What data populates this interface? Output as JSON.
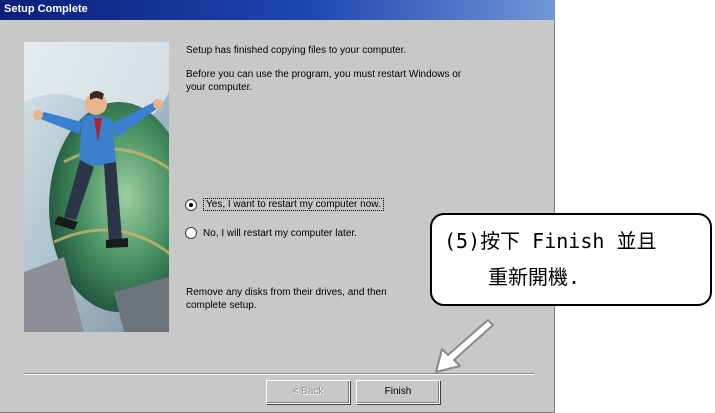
{
  "window": {
    "title": "Setup Complete"
  },
  "message": {
    "line1": "Setup has finished copying files to your computer.",
    "line2a": "Before you can use the program, you must restart Windows or",
    "line2b": "your computer."
  },
  "options": [
    {
      "label": "Yes, I want to restart my computer now.",
      "checked": true
    },
    {
      "label": "No, I will restart my computer later.",
      "checked": false
    }
  ],
  "instruction": {
    "line1": "Remove any disks from their drives, and then",
    "line2": "complete setup."
  },
  "buttons": {
    "back": "< Back",
    "finish": "Finish"
  },
  "callout": {
    "line1": "(5)按下 Finish 並且",
    "line2": "重新開機."
  },
  "colors": {
    "dialog_bg": "#c8c8c8",
    "titlebar": "#0a1f7a",
    "callout_border": "#000000"
  }
}
